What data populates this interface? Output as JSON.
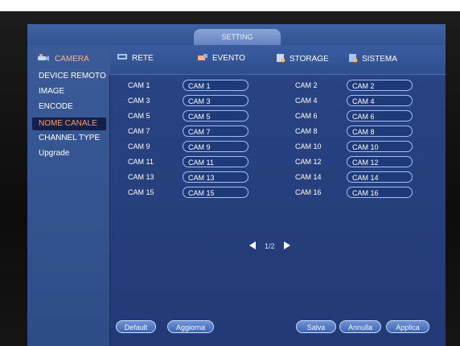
{
  "window": {
    "title": "SETTING"
  },
  "sidebar": {
    "header": "CAMERA",
    "items": [
      "DEVICE REMOTO",
      "IMAGE",
      "ENCODE",
      "NOME CANALE",
      "CHANNEL TYPE",
      "Upgrade"
    ],
    "active_index": 3
  },
  "nav": {
    "items": [
      "RETE",
      "EVENTO",
      "STORAGE",
      "SISTEMA"
    ]
  },
  "cameras": {
    "left": [
      {
        "label": "CAM 1",
        "value": "CAM 1"
      },
      {
        "label": "CAM 3",
        "value": "CAM 3"
      },
      {
        "label": "CAM 5",
        "value": "CAM 5"
      },
      {
        "label": "CAM 7",
        "value": "CAM 7"
      },
      {
        "label": "CAM 9",
        "value": "CAM 9"
      },
      {
        "label": "CAM 11",
        "value": "CAM 11"
      },
      {
        "label": "CAM 13",
        "value": "CAM 13"
      },
      {
        "label": "CAM 15",
        "value": "CAM 15"
      }
    ],
    "right": [
      {
        "label": "CAM 2",
        "value": "CAM 2"
      },
      {
        "label": "CAM 4",
        "value": "CAM 4"
      },
      {
        "label": "CAM 6",
        "value": "CAM 6"
      },
      {
        "label": "CAM 8",
        "value": "CAM 8"
      },
      {
        "label": "CAM 10",
        "value": "CAM 10"
      },
      {
        "label": "CAM 12",
        "value": "CAM 12"
      },
      {
        "label": "CAM 14",
        "value": "CAM 14"
      },
      {
        "label": "CAM 16",
        "value": "CAM 16"
      }
    ]
  },
  "pagination": {
    "text": "1/2"
  },
  "buttons": {
    "default": "Default",
    "refresh": "Aggiorna",
    "save": "Salva",
    "cancel": "Annulla",
    "apply": "Applica"
  },
  "colors": {
    "accent": "#ff9a63",
    "screen_bg": "#2d4a86"
  }
}
